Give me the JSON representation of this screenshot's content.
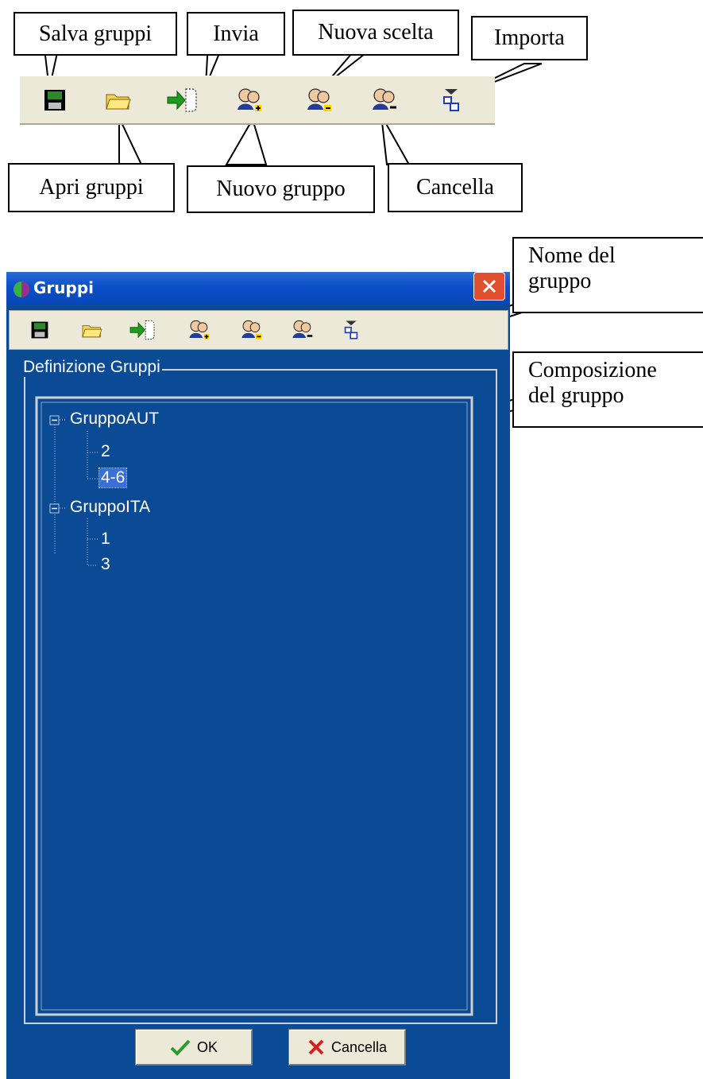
{
  "callouts": {
    "salva": "Salva gruppi",
    "invia": "Invia",
    "nuova_scelta": "Nuova scelta",
    "importa": "Importa",
    "apri": "Apri gruppi",
    "nuovo_gruppo": "Nuovo gruppo",
    "cancella": "Cancella",
    "nome_line1": "Nome del",
    "nome_line2": "gruppo",
    "composizione_line1": "Composizione",
    "composizione_line2": "del gruppo"
  },
  "toolbar_icons": [
    "save-icon",
    "open-folder-icon",
    "send-icon",
    "new-group-icon",
    "new-choice-icon",
    "delete-group-icon",
    "import-icon"
  ],
  "window": {
    "title": "Gruppi",
    "groupbox_label": "Definizione Gruppi",
    "tree": [
      {
        "label": "GruppoAUT",
        "children": [
          "2",
          "4-6"
        ],
        "selected_child": "4-6"
      },
      {
        "label": "GruppoITA",
        "children": [
          "1",
          "3"
        ]
      }
    ],
    "ok_label": "OK",
    "cancel_label": "Cancella"
  },
  "colors": {
    "window_bg": "#0b4a95",
    "titlebar": "#0b4fc9",
    "close": "#e0502e",
    "toolbar_bg": "#ece9d8"
  }
}
